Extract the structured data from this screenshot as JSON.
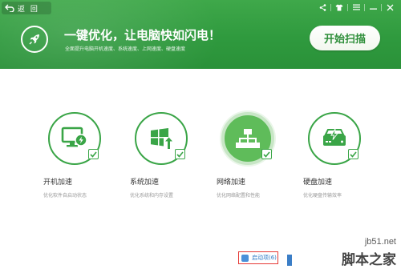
{
  "topbar": {
    "back_label": "返 回"
  },
  "header": {
    "headline": "一键优化，让电脑快如闪电！",
    "subline": "全面提升电脑开机速度、系统速度、上网速度、硬盘速度",
    "scan_button": "开始扫描"
  },
  "features": [
    {
      "title": "开机加速",
      "desc": "优化软件自启动状态",
      "icon": "monitor-bolt-icon",
      "checked": true
    },
    {
      "title": "系统加速",
      "desc": "优化系统和内存设置",
      "icon": "windows-icon",
      "checked": true
    },
    {
      "title": "网络加速",
      "desc": "优化网络配置和性能",
      "icon": "network-icon",
      "checked": true
    },
    {
      "title": "硬盘加速",
      "desc": "优化硬盘传输效率",
      "icon": "hdd-bolt-icon",
      "checked": true
    }
  ],
  "bottom": {
    "startup_link": "启动项(6)"
  },
  "watermark": {
    "url": "jb51.net",
    "name": "脚本之家"
  },
  "colors": {
    "header_green": "#2f9a3e",
    "accent_green": "#3aa547",
    "active_fill": "#5fbc5a",
    "highlight_red": "#e53935"
  }
}
